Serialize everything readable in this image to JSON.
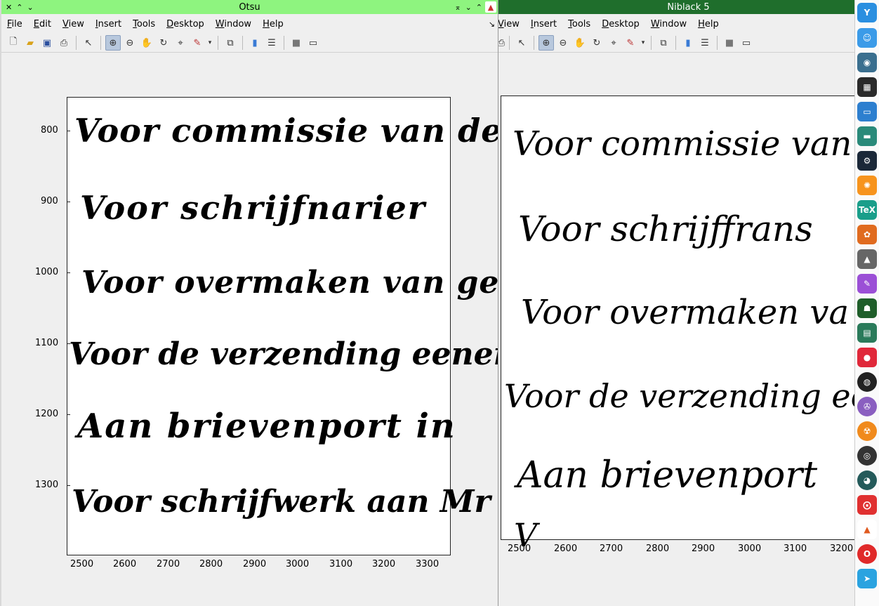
{
  "left_window": {
    "title": "Otsu",
    "menu": [
      "File",
      "Edit",
      "View",
      "Insert",
      "Tools",
      "Desktop",
      "Window",
      "Help"
    ],
    "y_ticks": [
      "800",
      "900",
      "1000",
      "1100",
      "1200",
      "1300"
    ],
    "x_ticks": [
      "2500",
      "2600",
      "2700",
      "2800",
      "2900",
      "3000",
      "3100",
      "3200",
      "3300"
    ],
    "lines": [
      "Voor commissie van de",
      "Voor schrijfnarier",
      "Voor overmaken van gel",
      "Voor de verzending eener ve",
      "Aan brievenport in",
      "Voor schrijfwerk aan Mr"
    ]
  },
  "right_window": {
    "title": "Niblack 5",
    "menu": [
      "View",
      "Insert",
      "Tools",
      "Desktop",
      "Window",
      "Help"
    ],
    "x_ticks": [
      "2500",
      "2600",
      "2700",
      "2800",
      "2900",
      "3000",
      "3100",
      "3200"
    ],
    "lines": [
      "Voor commissie van",
      "Voor schrijffrans",
      "Voor overmaken va",
      "Voor de verzending eene",
      "Aan brievenport",
      "V"
    ]
  },
  "colors": {
    "left_title": "#8ef47f",
    "right_title": "#1f6e2c",
    "active_tool": "#b8c8dd"
  },
  "dock": [
    "yahoo-icon",
    "finder-icon",
    "disk-icon",
    "terminal-icon",
    "monitor-icon",
    "files-icon",
    "steam-icon",
    "orange-icon",
    "tex-icon",
    "paint-icon",
    "inkscape-icon",
    "brush-icon",
    "game-icon",
    "video-icon",
    "record-icon",
    "obs-icon",
    "radiation-icon",
    "nuclear-icon",
    "disc-icon",
    "gimp-icon",
    "pdf-icon",
    "matlab-icon",
    "opera-icon",
    "telegram-icon"
  ]
}
